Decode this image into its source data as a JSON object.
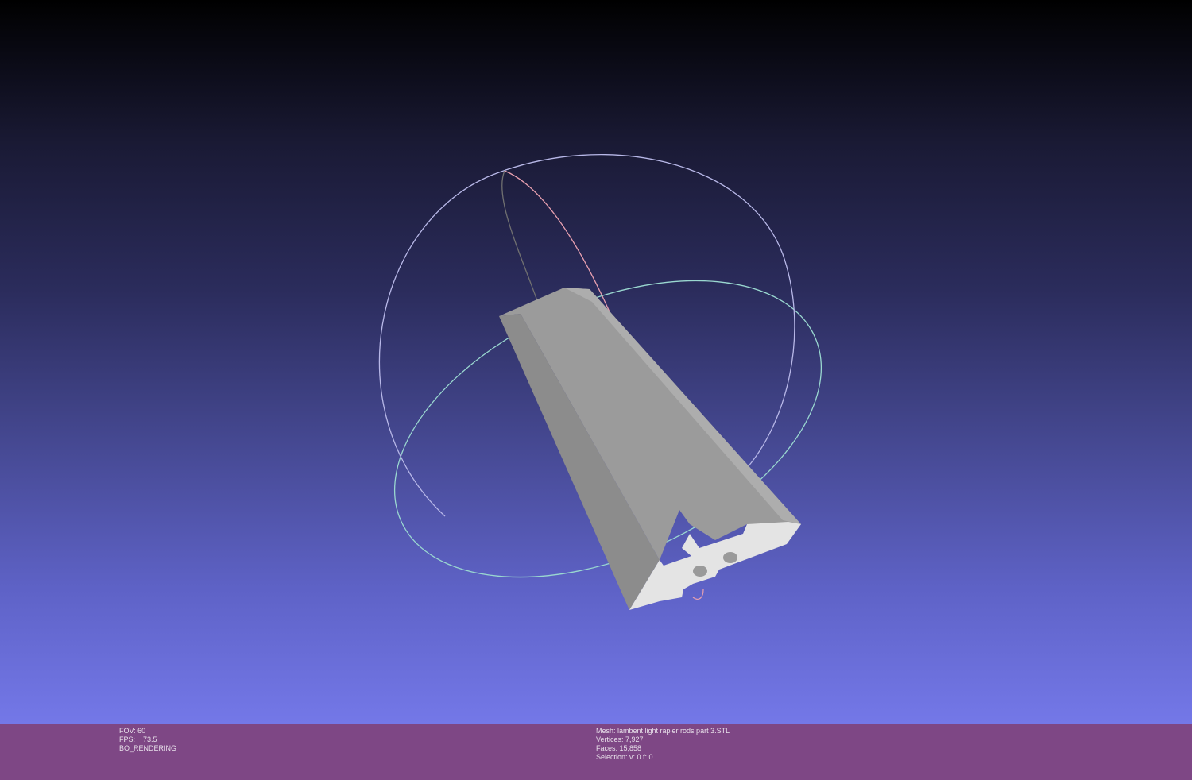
{
  "viewport": {
    "background_top": "#000000",
    "background_bottom": "#7478e8",
    "mesh_color": "#9a9a9a"
  },
  "status_left": {
    "fov": "FOV: 60",
    "fps": "FPS:    73.5",
    "render_mode": "BO_RENDERING"
  },
  "status_right": {
    "mesh": "Mesh: lambent light rapier rods part 3.STL",
    "vertices": "Vertices: 7,927",
    "faces": "Faces: 15,858",
    "selection": "Selection: v: 0 f: 0"
  },
  "statusbar_color": "#7e4785"
}
